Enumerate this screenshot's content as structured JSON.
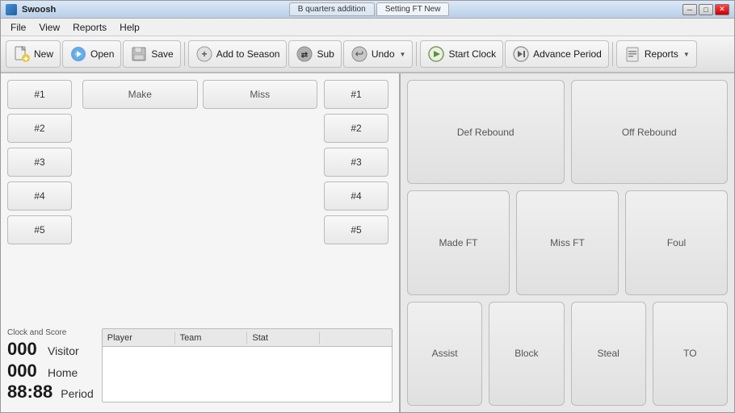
{
  "window": {
    "title": "Swoosh",
    "tab1": "B quarters addition",
    "tab2": "Setting FT New"
  },
  "menu": {
    "items": [
      "File",
      "View",
      "Reports",
      "Help"
    ]
  },
  "toolbar": {
    "new_label": "New",
    "open_label": "Open",
    "save_label": "Save",
    "add_to_season_label": "Add to Season",
    "sub_label": "Sub",
    "undo_label": "Undo",
    "start_clock_label": "Start Clock",
    "advance_period_label": "Advance Period",
    "reports_label": "Reports"
  },
  "home_team": {
    "players": [
      "#1",
      "#2",
      "#3",
      "#4",
      "#5"
    ]
  },
  "visitor_team": {
    "players": [
      "#1",
      "#2",
      "#3",
      "#4",
      "#5"
    ]
  },
  "shot_buttons": {
    "make": "Make",
    "miss": "Miss"
  },
  "clock_score": {
    "label": "Clock and Score",
    "visitor_score": "000",
    "visitor_label": "Visitor",
    "home_score": "000",
    "home_label": "Home",
    "period_time": "88:88",
    "period_label": "Period"
  },
  "stats_table": {
    "columns": [
      "Player",
      "Team",
      "Stat",
      ""
    ]
  },
  "action_buttons": {
    "row1": [
      "Def Rebound",
      "Off Rebound"
    ],
    "row2": [
      "Made FT",
      "Miss FT",
      "Foul"
    ],
    "row3": [
      "Assist",
      "Block",
      "Steal",
      "TO"
    ]
  }
}
